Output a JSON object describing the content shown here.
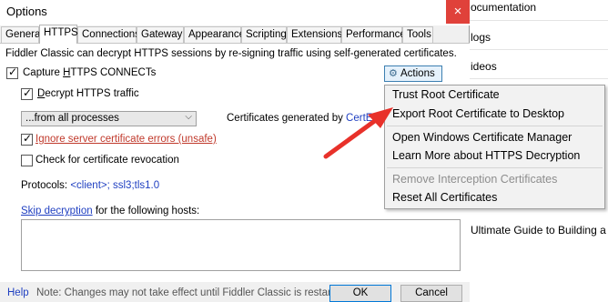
{
  "background_page": {
    "links": [
      "ocumentation",
      "logs",
      "ideos",
      "Ultimate Guide to Building a UI Li"
    ]
  },
  "dialog": {
    "title": "Options",
    "close_glyph": "×",
    "tabs": [
      "General",
      "HTTPS",
      "Connections",
      "Gateway",
      "Appearance",
      "Scripting",
      "Extensions",
      "Performance",
      "Tools"
    ],
    "active_tab": "HTTPS",
    "description": "Fiddler Classic can decrypt HTTPS sessions by re-signing traffic using self-generated certificates.",
    "capture_label_pre": "Capture ",
    "capture_label_u": "H",
    "capture_label_post": "TTPS CONNECTs",
    "capture_checked": true,
    "decrypt_label_pre": "",
    "decrypt_label_u": "D",
    "decrypt_label_post": "ecrypt HTTPS traffic",
    "decrypt_checked": true,
    "process_filter": "...from all processes",
    "certs_generated_prefix": "Certificates generated by ",
    "certs_generated_link": "CertEnroll",
    "ignore_errors_label": "Ignore server certificate errors (unsafe)",
    "ignore_errors_checked": true,
    "revocation_label": "Check for certificate revocation",
    "revocation_checked": false,
    "protocols_label": "Protocols: ",
    "protocols_value": "<client>; ssl3;tls1.0",
    "skip_link": "Skip decryption",
    "skip_suffix": " for the following hosts:",
    "hosts_value": "",
    "actions_label": "Actions",
    "actions_icon": "gear-icon",
    "footer": {
      "help": "Help",
      "note": "Note: Changes may not take effect until Fiddler Classic is restarted.",
      "ok": "OK",
      "cancel": "Cancel"
    }
  },
  "actions_menu": {
    "items": [
      {
        "label": "Trust Root Certificate",
        "enabled": true
      },
      {
        "label": "Export Root Certificate to Desktop",
        "enabled": true
      },
      {
        "label": "Open Windows Certificate Manager",
        "enabled": true
      },
      {
        "label": "Learn More about HTTPS Decryption",
        "enabled": true
      },
      {
        "label": "Remove Interception Certificates",
        "enabled": false
      },
      {
        "label": "Reset All Certificates",
        "enabled": true
      }
    ]
  },
  "annotation": {
    "arrow_color": "#e8312a"
  }
}
